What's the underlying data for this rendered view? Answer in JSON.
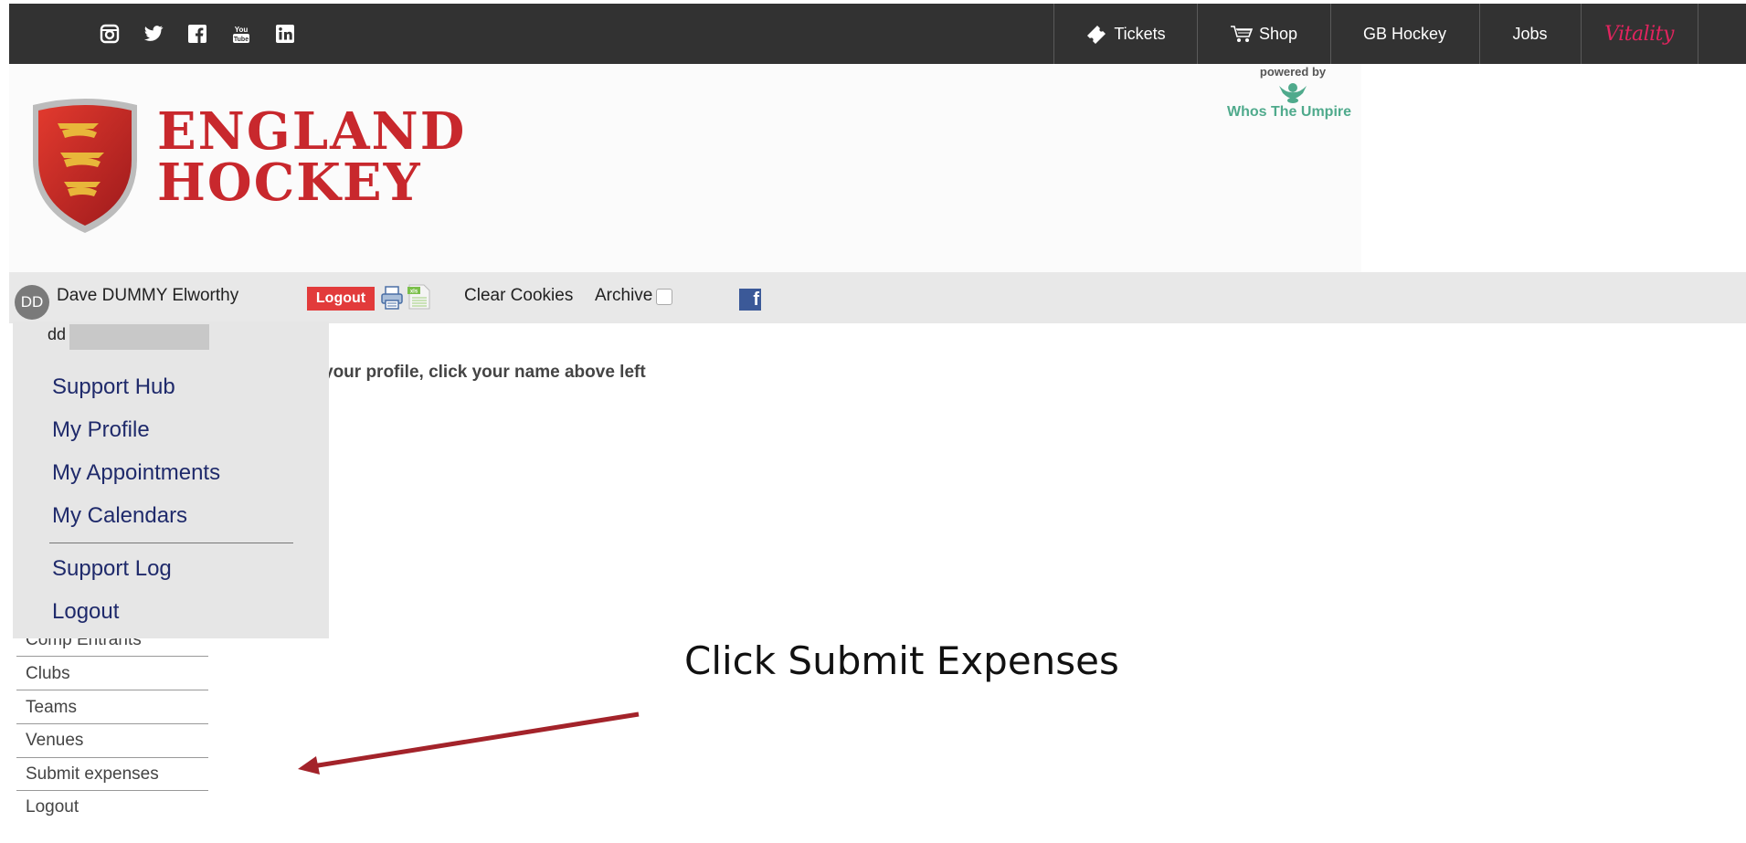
{
  "topbar": {
    "social": [
      "instagram-icon",
      "twitter-icon",
      "facebook-icon",
      "youtube-icon",
      "linkedin-icon"
    ],
    "nav": {
      "tickets": "Tickets",
      "shop": "Shop",
      "gb_hockey": "GB Hockey",
      "jobs": "Jobs",
      "vitality": "Vitality"
    }
  },
  "header": {
    "brand_line1": "ENGLAND",
    "brand_line2": "HOCKEY",
    "powered_by": "powered by",
    "powered_brand": "Whos The Umpire"
  },
  "userbar": {
    "initials": "DD",
    "user_name": "Dave DUMMY Elworthy",
    "logout": "Logout",
    "clear_cookies": "Clear Cookies",
    "archive": "Archive",
    "archive_checked": false
  },
  "hint": "your profile, click your name above left",
  "dropdown": {
    "handle": "dd",
    "items": [
      "Support Hub",
      "My Profile",
      "My Appointments",
      "My Calendars",
      "Support Log",
      "Logout"
    ]
  },
  "side_menu": [
    "Comp Entrants",
    "Clubs",
    "Teams",
    "Venues",
    "Submit expenses",
    "Logout"
  ],
  "annotation": "Click Submit Expenses",
  "colors": {
    "topbar": "#323232",
    "brand_red": "#c8282d",
    "logout_button": "#e23b3b",
    "dropdown_link": "#1f2a6b",
    "annotation_arrow": "#a3232a",
    "vitality": "#e0245e"
  }
}
